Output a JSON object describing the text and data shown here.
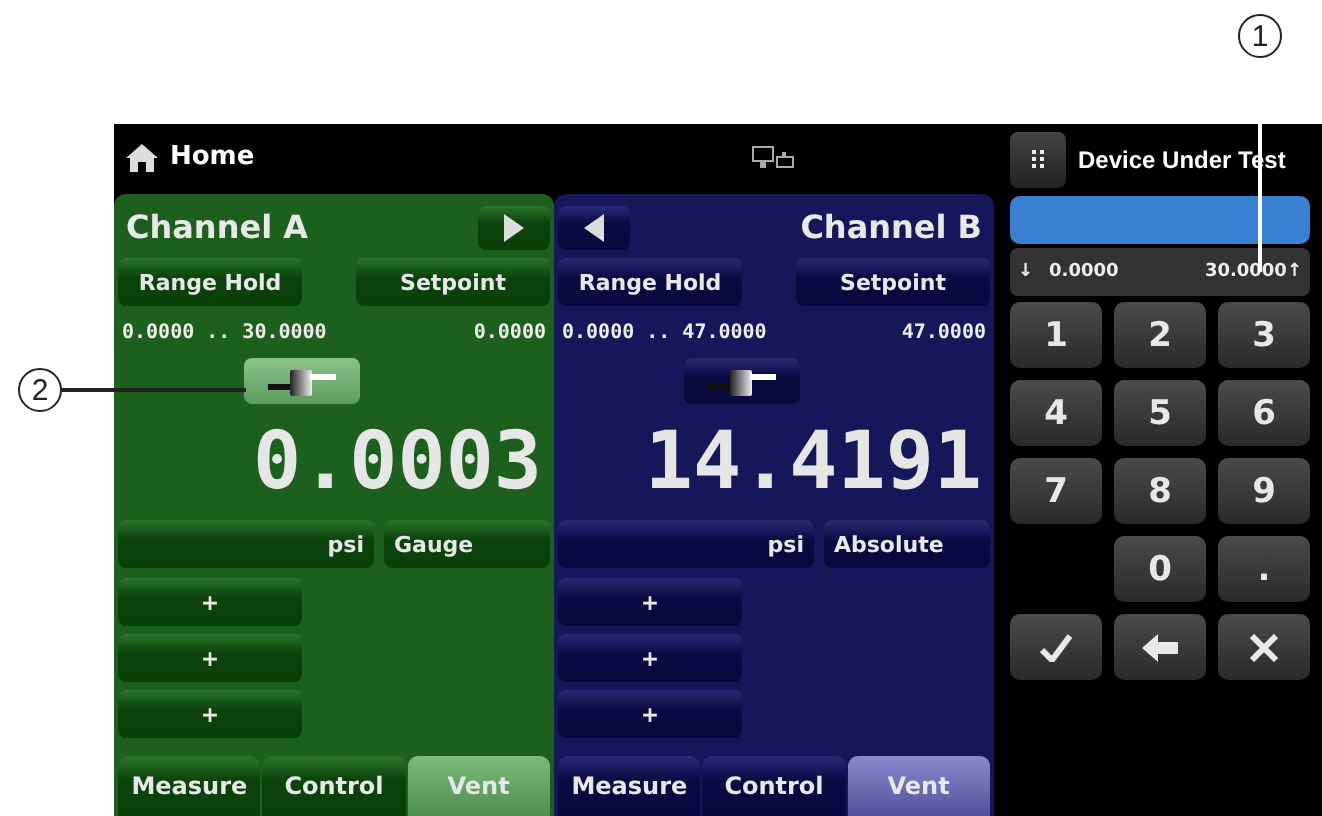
{
  "header": {
    "title": "Home"
  },
  "channels": [
    {
      "name": "Channel A",
      "kind": "green",
      "nav_first": false,
      "buttons": [
        "Range Hold",
        "Setpoint"
      ],
      "range_low": "0.0000",
      "range_sep": "..",
      "range_high": "30.0000",
      "setpoint": "0.0000",
      "valve_active": true,
      "reading": "0.0003",
      "unit": "psi",
      "mode": "Gauge",
      "slots": [
        "+",
        "+",
        "+"
      ],
      "tabs": [
        {
          "label": "Measure",
          "selected": false
        },
        {
          "label": "Control",
          "selected": false
        },
        {
          "label": "Vent",
          "selected": true
        }
      ]
    },
    {
      "name": "Channel B",
      "kind": "blue",
      "nav_first": true,
      "buttons": [
        "Range Hold",
        "Setpoint"
      ],
      "range_low": "0.0000",
      "range_sep": "..",
      "range_high": "47.0000",
      "setpoint": "47.0000",
      "valve_active": false,
      "reading": "14.4191",
      "unit": "psi",
      "mode": "Absolute",
      "slots": [
        "+",
        "+",
        "+"
      ],
      "tabs": [
        {
          "label": "Measure",
          "selected": false
        },
        {
          "label": "Control",
          "selected": false
        },
        {
          "label": "Vent",
          "selected": true
        }
      ]
    }
  ],
  "keypad": {
    "title": "Device Under Test",
    "low_marker": "↓",
    "low": "0.0000",
    "high": "30.0000",
    "high_marker": "↑",
    "keys": [
      {
        "kind": "text",
        "label": "1"
      },
      {
        "kind": "text",
        "label": "2"
      },
      {
        "kind": "text",
        "label": "3"
      },
      {
        "kind": "text",
        "label": "4"
      },
      {
        "kind": "text",
        "label": "5"
      },
      {
        "kind": "text",
        "label": "6"
      },
      {
        "kind": "text",
        "label": "7"
      },
      {
        "kind": "text",
        "label": "8"
      },
      {
        "kind": "text",
        "label": "9"
      },
      {
        "kind": "blank"
      },
      {
        "kind": "text",
        "label": "0"
      },
      {
        "kind": "text",
        "label": "."
      },
      {
        "kind": "check"
      },
      {
        "kind": "back"
      },
      {
        "kind": "clear"
      }
    ]
  },
  "callouts": [
    {
      "label": "1",
      "kind": "vertical"
    },
    {
      "label": "2",
      "kind": "horizontal"
    }
  ]
}
